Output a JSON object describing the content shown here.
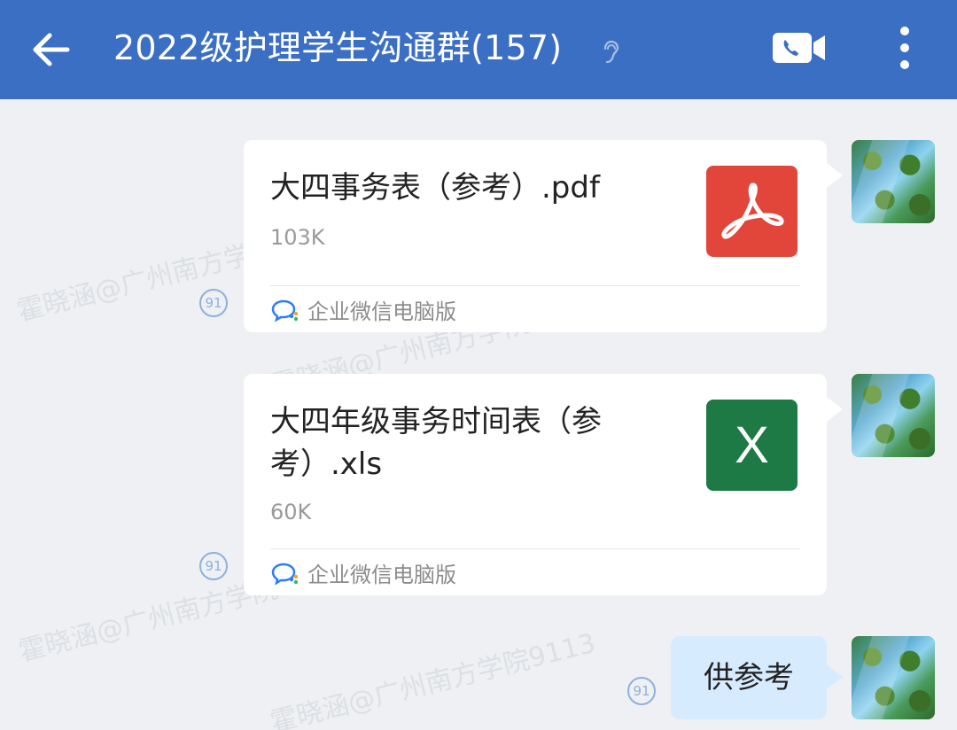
{
  "header": {
    "title": "2022级护理学生沟通群(157)",
    "back_icon": "back-arrow-icon",
    "ear_icon": "ear-icon",
    "video_icon": "video-call-icon",
    "more_icon": "more-vertical-icon",
    "background": "#3b6fc4"
  },
  "watermarks": [
    "霍晓涵@广州南方学院9113",
    "霍晓涵@广州南方学院9113",
    "霍晓涵@广州南方学院9113",
    "霍晓涵@广州南方学院9113"
  ],
  "messages": [
    {
      "type": "file",
      "file_name": "大四事务表（参考）.pdf",
      "size": "103K",
      "source": "企业微信电脑版",
      "read_count": "91",
      "icon": "pdf-icon",
      "icon_color": "#e2453a"
    },
    {
      "type": "file",
      "file_name": "大四年级事务时间表（参考）.xls",
      "size": "60K",
      "source": "企业微信电脑版",
      "read_count": "91",
      "icon": "excel-icon",
      "icon_letter": "X",
      "icon_color": "#1e7a44"
    },
    {
      "type": "text",
      "text": "供参考",
      "read_count": "91",
      "bubble_color": "#d7ebff"
    }
  ]
}
